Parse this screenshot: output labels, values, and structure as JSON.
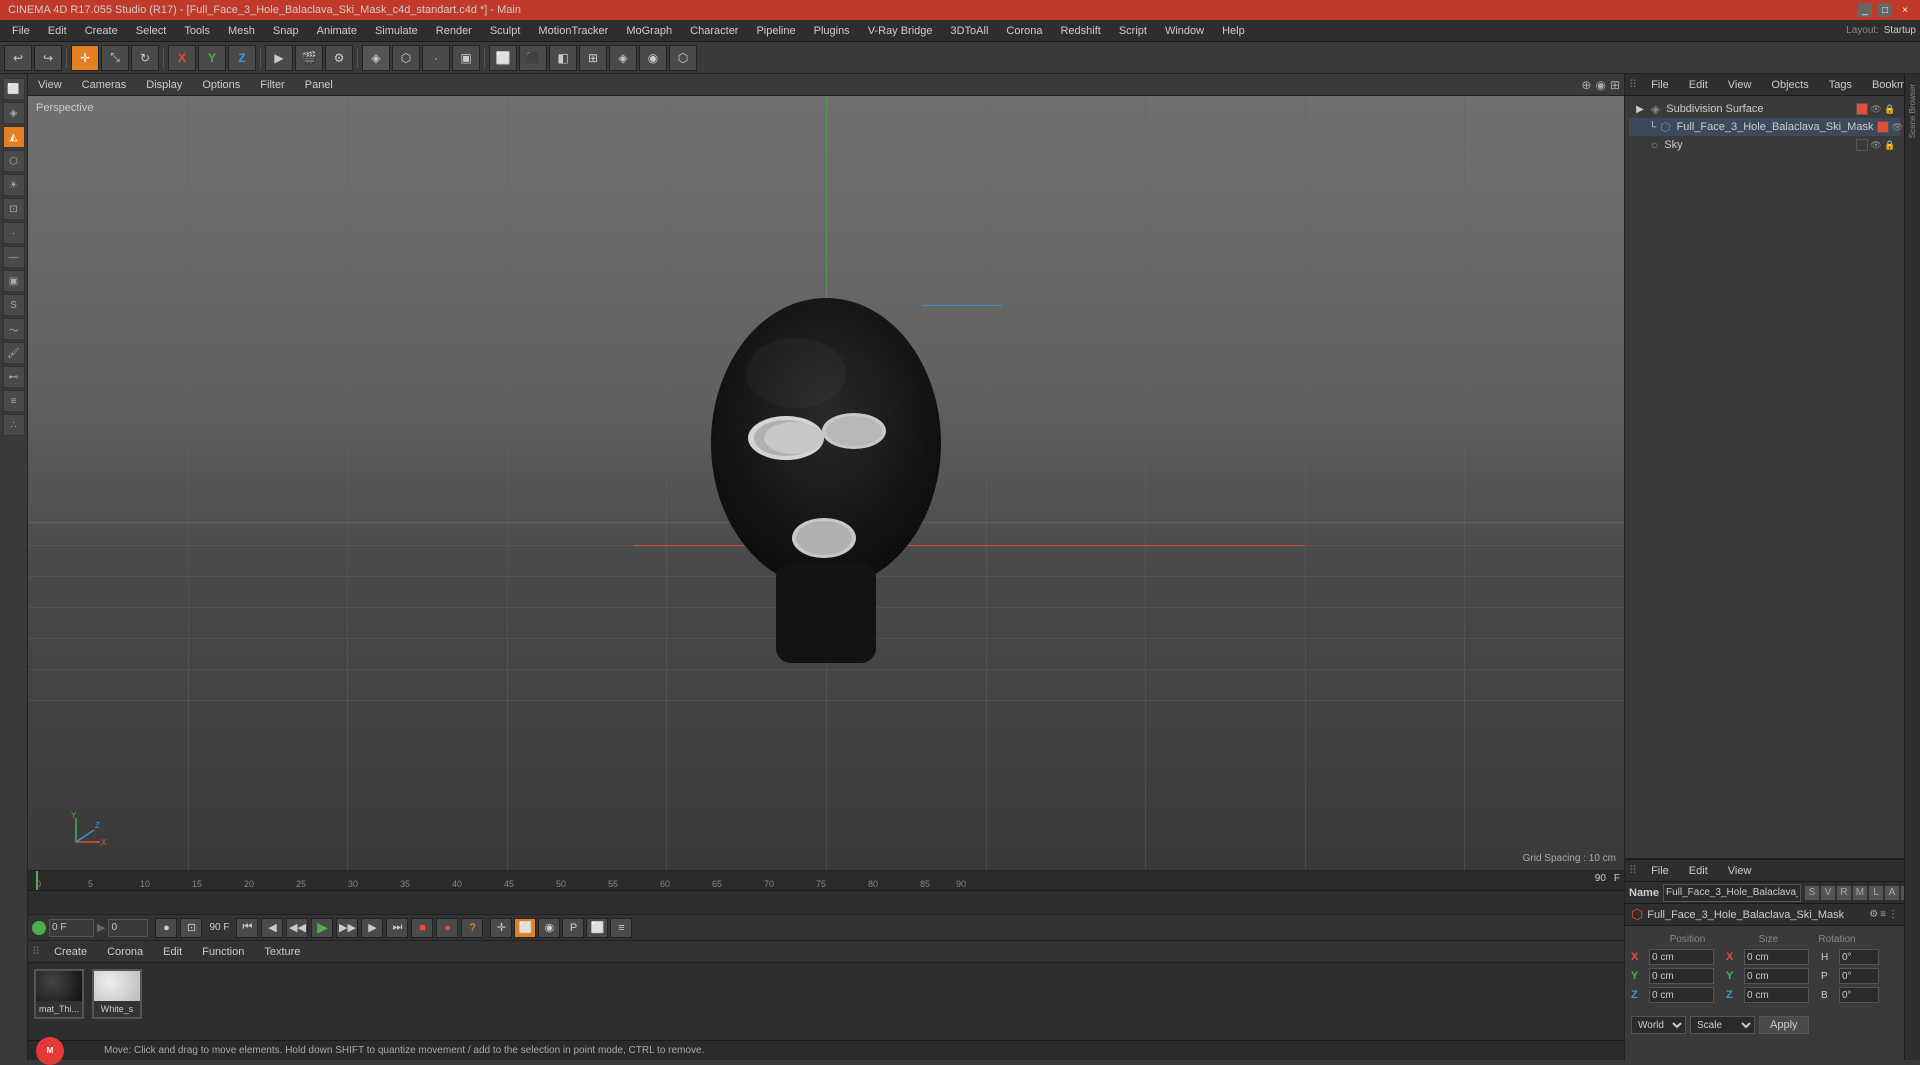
{
  "titleBar": {
    "text": "CINEMA 4D R17.055 Studio (R17) - [Full_Face_3_Hole_Balaclava_Ski_Mask_c4d_standart.c4d *] - Main",
    "controls": [
      "_",
      "□",
      "×"
    ]
  },
  "menuBar": {
    "items": [
      "File",
      "Edit",
      "Create",
      "Select",
      "Tools",
      "Mesh",
      "Snap",
      "Animate",
      "Simulate",
      "Render",
      "Sculpt",
      "MotionTracker",
      "MoGraph",
      "Character",
      "Pipeline",
      "Plugins",
      "V-Ray Bridge",
      "3DToAll",
      "Corona",
      "Redshift",
      "Script",
      "Window",
      "Help"
    ]
  },
  "viewport": {
    "label": "Perspective",
    "gridSpacing": "Grid Spacing : 10 cm",
    "menuItems": [
      "View",
      "Cameras",
      "Display",
      "Options",
      "Filter",
      "Panel"
    ]
  },
  "rightPanel": {
    "topToolbar": [
      "File",
      "Edit",
      "View",
      "Objects",
      "Tags",
      "Bookmarks"
    ],
    "objects": [
      {
        "name": "Subdivision Surface",
        "color": "#e74c3c",
        "indent": 0,
        "icon": "◈"
      },
      {
        "name": "Full_Face_3_Hole_Balaclava_Ski_Mask",
        "color": "#e74c3c",
        "indent": 1,
        "icon": "⬡"
      },
      {
        "name": "Sky",
        "color": "",
        "indent": 0,
        "icon": "○"
      }
    ],
    "bottomToolbar": [
      "File",
      "Edit",
      "View"
    ],
    "objectName": {
      "label": "Name",
      "value": "Full_Face_3_Hole_Balaclava_Ski_Mask"
    },
    "coords": {
      "x": {
        "pos": "0 cm",
        "size": "0 cm",
        "h": "0°"
      },
      "y": {
        "pos": "0 cm",
        "size": "0 cm",
        "p": "0°"
      },
      "z": {
        "pos": "0 cm",
        "size": "0 cm",
        "b": "0°"
      }
    },
    "coordDropdowns": {
      "world": "World",
      "scale": "Scale",
      "applyBtn": "Apply"
    }
  },
  "timeline": {
    "startFrame": "0 F",
    "endFrame": "90 F",
    "currentFrame": "0 F",
    "inputValue": "0",
    "ticks": [
      "0",
      "5",
      "10",
      "15",
      "20",
      "25",
      "30",
      "35",
      "40",
      "45",
      "50",
      "55",
      "60",
      "65",
      "70",
      "75",
      "80",
      "85",
      "90"
    ]
  },
  "materialEditor": {
    "tabs": [
      "Create",
      "Corona",
      "Edit",
      "Function",
      "Texture"
    ],
    "materials": [
      {
        "name": "mat_Thi...",
        "colorTop": "#1a1a1a"
      },
      {
        "name": "White_s",
        "colorTop": "#e8e8e8"
      }
    ]
  },
  "statusBar": {
    "text": "Move: Click and drag to move elements. Hold down SHIFT to quantize movement / add to the selection in point mode, CTRL to remove."
  },
  "layoutLabel": "Layout:",
  "layoutValue": "Startup",
  "icons": {
    "undo": "↩",
    "move": "✛",
    "scale": "⤡",
    "rotate": "↻",
    "x_axis": "X",
    "y_axis": "Y",
    "z_axis": "Z",
    "play": "▶",
    "stop": "■",
    "prev": "◀◀",
    "next": "▶▶",
    "record": "●",
    "rewind": "⏮",
    "ff": "⏭"
  }
}
